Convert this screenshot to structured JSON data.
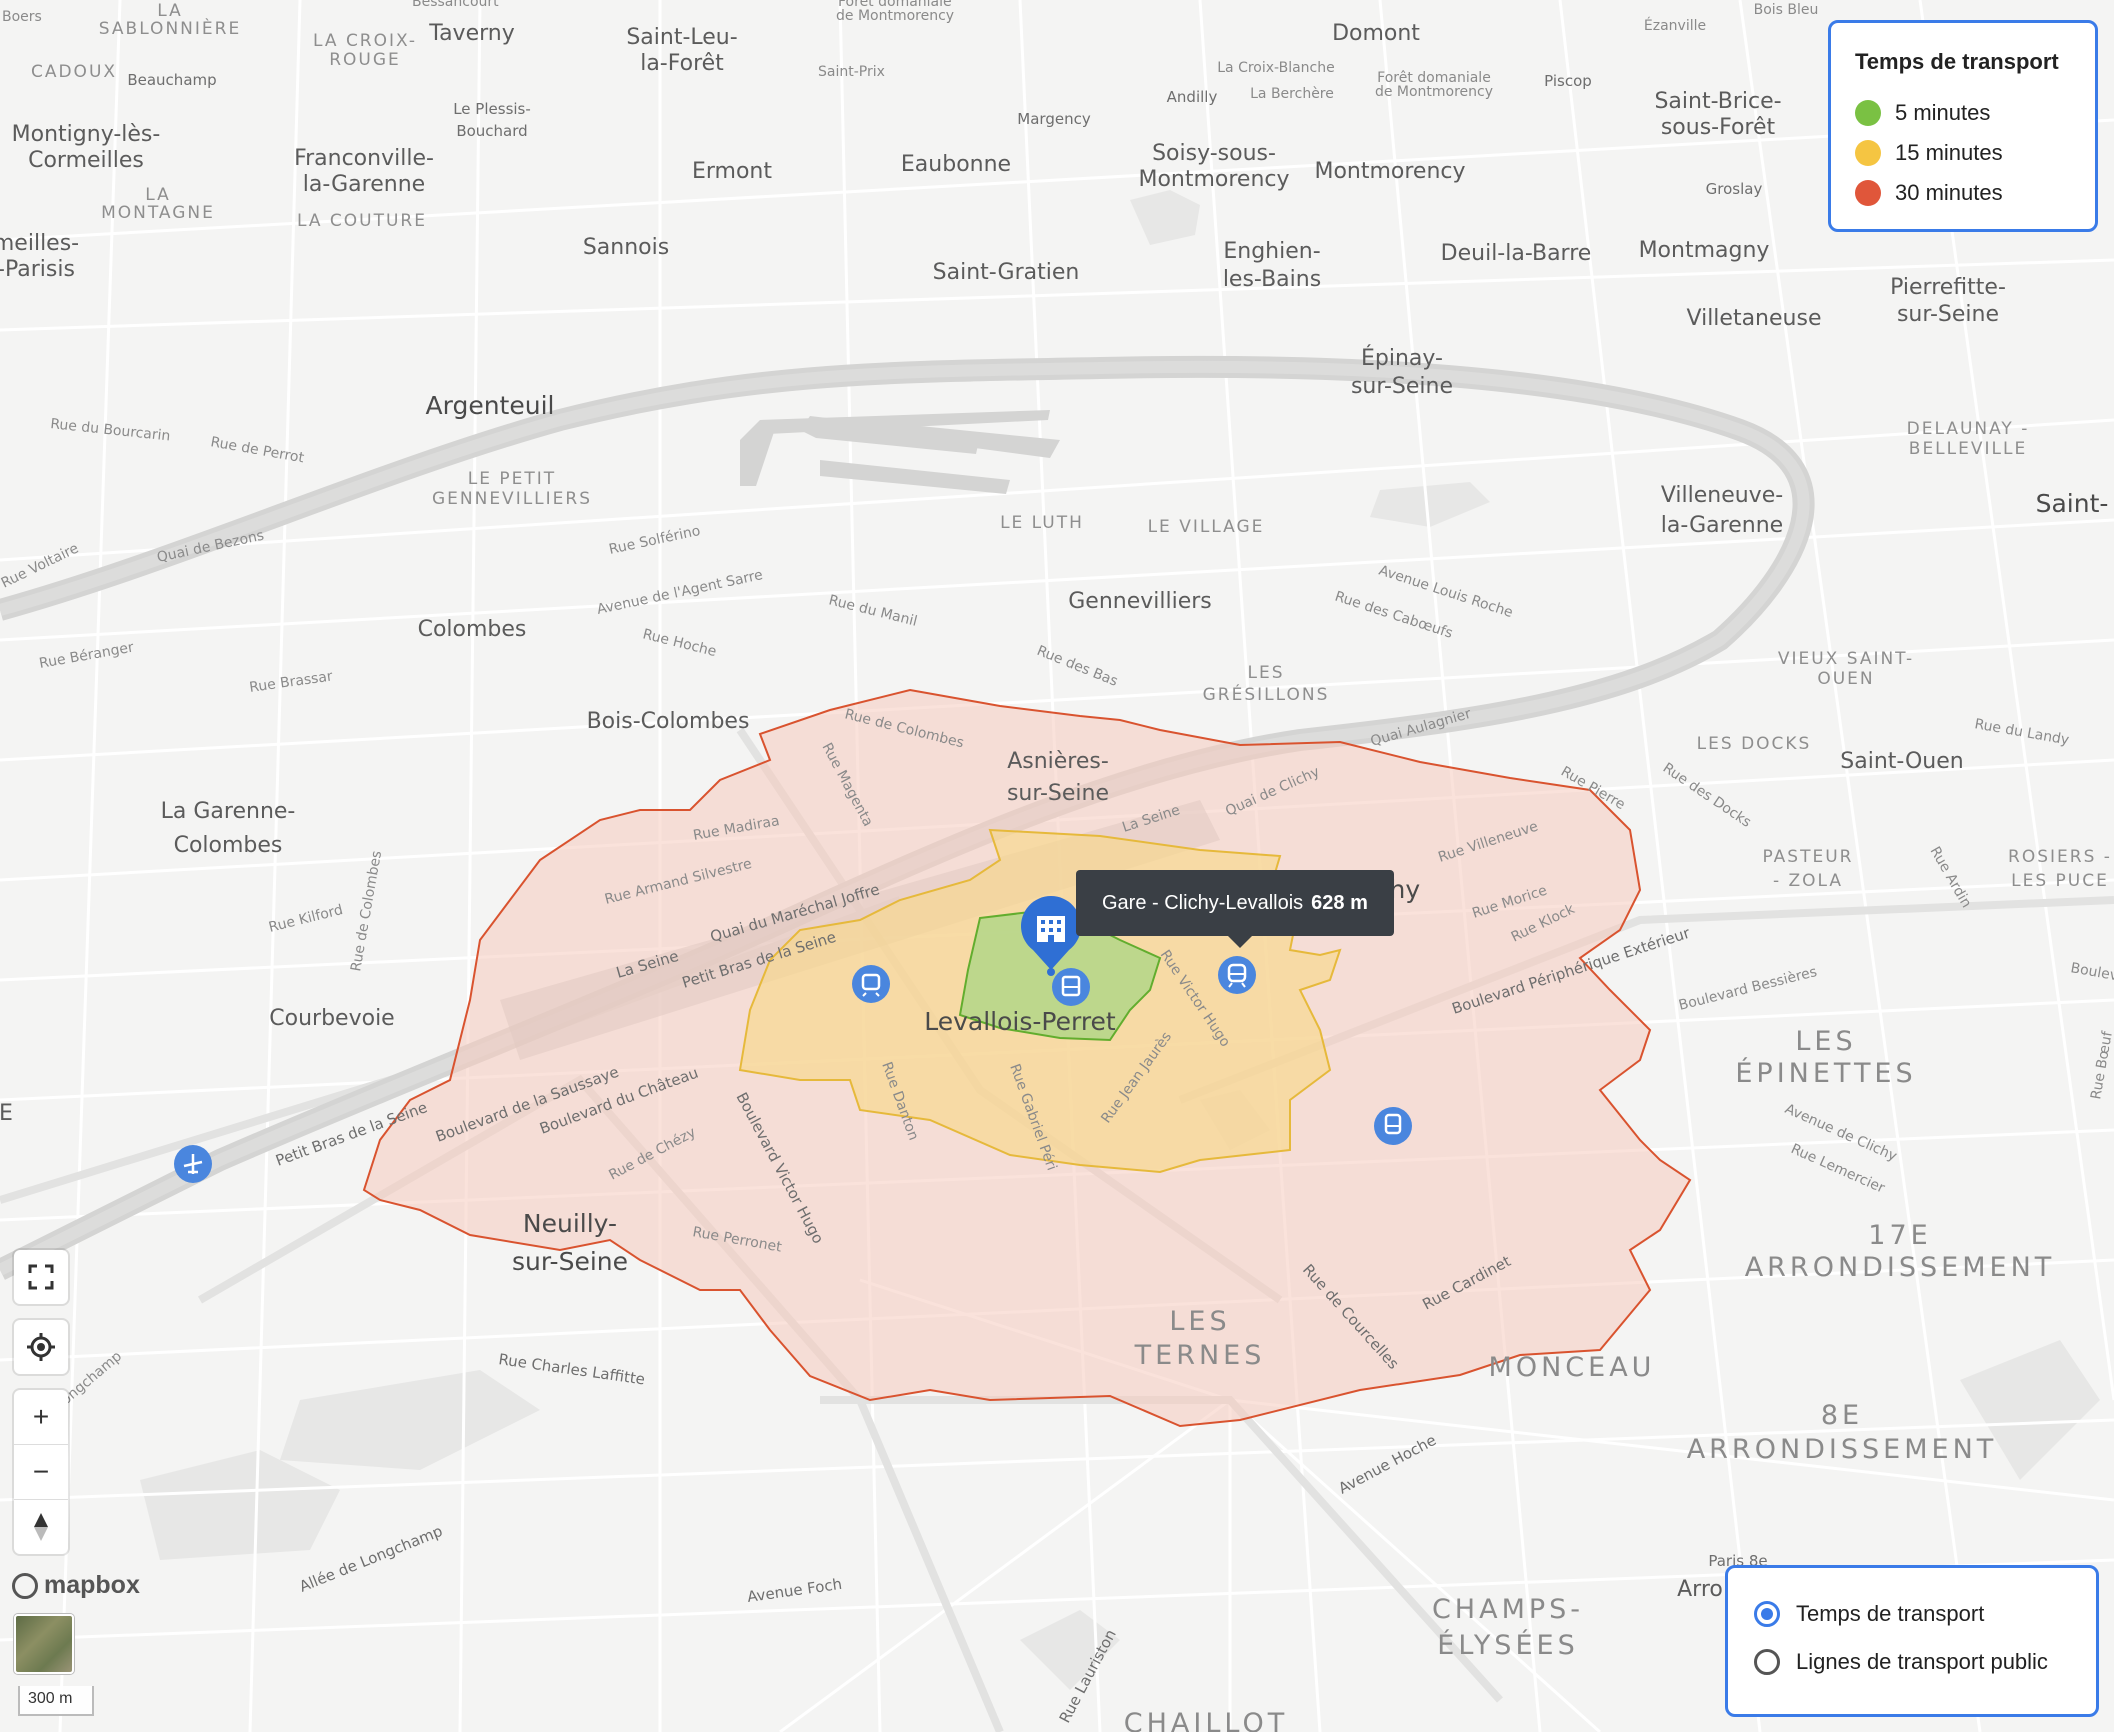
{
  "legend": {
    "title": "Temps de transport",
    "items": [
      {
        "label": "5 minutes",
        "color": "#7ac143"
      },
      {
        "label": "15 minutes",
        "color": "#f5c542"
      },
      {
        "label": "30 minutes",
        "color": "#e0563a"
      }
    ]
  },
  "layer_switch": {
    "options": [
      {
        "label": "Temps de transport",
        "selected": true
      },
      {
        "label": "Lignes de transport public",
        "selected": false
      }
    ]
  },
  "tooltip": {
    "name": "Gare - Clichy-Levallois",
    "distance": "628 m"
  },
  "scale": "300 m",
  "attribution": "mapbox",
  "controls": {
    "fullscreen": "fullscreen-icon",
    "locate": "locate-icon",
    "zoom_in": "+",
    "zoom_out": "−",
    "compass": "compass-icon"
  },
  "places": {
    "boers": "Boers",
    "sablonniere": "SABLONNIÈRE",
    "la": "LA",
    "lacroix1": "LA CROIX-",
    "lacroix2": "ROUGE",
    "bessancourt": "Bessancourt",
    "taverny": "Taverny",
    "saintleu1": "Saint-Leu-",
    "saintleu2": "la-Forêt",
    "foretmont1": "Forêt domaniale",
    "foretmont2": "de Montmorency",
    "saintprix": "Saint-Prix",
    "domont": "Domont",
    "ezanville": "Ézanville",
    "boisbleu": "Bois Bleu",
    "cadoux": "CADOUX",
    "beauchamp": "Beauchamp",
    "plessis1": "Le Plessis-",
    "plessis2": "Bouchard",
    "lacroixblanche": "La Croix-Blanche",
    "andilly": "Andilly",
    "laberchere": "La Berchère",
    "foretdom1": "Forêt domaniale",
    "foretdom2": "de Montmorency",
    "piscop": "Piscop",
    "saintbrice1": "Saint-Brice-",
    "saintbrice2": "sous-Forêt",
    "montigny1": "Montigny-lès-",
    "montigny2": "Cormeilles",
    "franconville1": "Franconville-",
    "franconville2": "la-Garenne",
    "margency": "Margency",
    "eaubonne": "Eaubonne",
    "ermont": "Ermont",
    "soisy1": "Soisy-sous-",
    "soisy2": "Montmorency",
    "montmorency": "Montmorency",
    "groslay": "Groslay",
    "lamontagne1": "LA",
    "lamontagne2": "MONTAGNE",
    "lacouture": "LA COUTURE",
    "cormeilles1": "meilles-",
    "cormeilles2": "-Parisis",
    "sannois": "Sannois",
    "saintgratien": "Saint-Gratien",
    "enghien1": "Enghien-",
    "enghien2": "les-Bains",
    "deuil": "Deuil-la-Barre",
    "montmagny": "Montmagny",
    "pierrefitte1": "Pierrefitte-",
    "pierrefitte2": "sur-Seine",
    "villetaneuse": "Villetaneuse",
    "epinay1": "Épinay-",
    "epinay2": "sur-Seine",
    "argenteuil": "Argenteuil",
    "lepetit1": "LE PETIT",
    "lepetit2": "GENNEVILLIERS",
    "delaunay1": "DELAUNAY -",
    "delaunay2": "BELLEVILLE",
    "villeneuve1": "Villeneuve-",
    "villeneuve2": "la-Garenne",
    "saint": "Saint-",
    "leluth": "LE LUTH",
    "levillage": "LE VILLAGE",
    "gennevilliers": "Gennevilliers",
    "colombes": "Colombes",
    "lesgresillons1": "LES",
    "lesgresillons2": "GRÉSILLONS",
    "vieuxsaintouen1": "VIEUX SAINT-",
    "vieuxsaintouen2": "OUEN",
    "boiscolombes": "Bois-Colombes",
    "asnieres1": "Asnières-",
    "asnieres2": "sur-Seine",
    "lesdocks": "LES DOCKS",
    "saintouen": "Saint-Ouen",
    "lagarenne1": "La Garenne-",
    "lagarenne2": "Colombes",
    "clichy": "chy",
    "pasteur1": "PASTEUR",
    "pasteur2": "- ZOLA",
    "rosiers1": "ROSIERS -",
    "rosiers2": "LES PUCE",
    "courbevoie": "Courbevoie",
    "levallois": "Levallois-Perret",
    "lesepinettes1": "LES",
    "lesepinettes2": "ÉPINETTES",
    "neuilly1": "Neuilly-",
    "neuilly2": "sur-Seine",
    "arr17a": "17E",
    "arr17b": "ARRONDISSEMENT",
    "lesternes1": "LES",
    "lesternes2": "TERNES",
    "monceau": "MONCEAU",
    "arr8a": "8E",
    "arr8b": "ARRONDISSEMENT",
    "champs1": "CHAMPS-",
    "champs2": "ÉLYSÉES",
    "chaillot": "CHAILLOT",
    "paris": "Paris 8e",
    "arro": "Arro",
    "e": "E"
  },
  "streets": {
    "s1": "Rue de Colombes",
    "s2": "Rue Magenta",
    "s3": "Rue Madiraa",
    "s4": "Rue Armand Silvestre",
    "s5": "Quai du Maréchal Joffre",
    "s6": "La Seine",
    "s7": "Petit Bras de la Seine",
    "s8": "Rue Kilford",
    "s9": "Rue de Colombes",
    "s10": "Boulevard de la Saussaye",
    "s11": "Boulevard du Château",
    "s12": "Rue de Chézy",
    "s13": "Boulevard Victor Hugo",
    "s14": "Rue Perronet",
    "s15": "Petit Bras de la Seine",
    "s16": "Rue Charles Laffitte",
    "s17": "Allée de Longchamp",
    "s18": "Avenue Foch",
    "s19": "Avenue Hoche",
    "s20": "Rue Lauriston",
    "s21": "Rue de Courcelles",
    "s22": "Rue Cardinet",
    "s23": "Rue Jean Jaurès",
    "s24": "Rue Gabriel Péri",
    "s25": "Rue Danton",
    "s26": "Rue Victor Hugo",
    "s27": "Quai de Clichy",
    "s28": "La Seine",
    "s29": "Rue Villeneuve",
    "s30": "Rue Morice",
    "s31": "Rue Klock",
    "s32": "Boulevard Périphérique Extérieur",
    "s33": "Boulevard Bessières",
    "s34": "Avenue de Clichy",
    "s35": "Rue Lemercier",
    "s36": "Rue Béranger",
    "s37": "Rue Brassar",
    "s38": "Quai de Bezons",
    "s39": "Rue Solférino",
    "s40": "Avenue de l'Agent Sarre",
    "s41": "Rue du Manil",
    "s42": "Rue Hoche",
    "s43": "Rue des Bas",
    "s44": "Avenue Louis Roche",
    "s45": "Rue des Cabœufs",
    "s46": "Quai Aulagnier",
    "s47": "Rue du Landy",
    "s48": "Rue des Docks",
    "s49": "Rue Voltaire",
    "s50": "Rue Pierre",
    "s51": "Rue Ardin",
    "s52": "Rue Bœuf",
    "s53": "Boulevar",
    "s54": "Longchamp",
    "s55": "Rue du Bourcarin",
    "s56": "Rue de Perrot",
    "s57": "Rue Lemercier"
  }
}
